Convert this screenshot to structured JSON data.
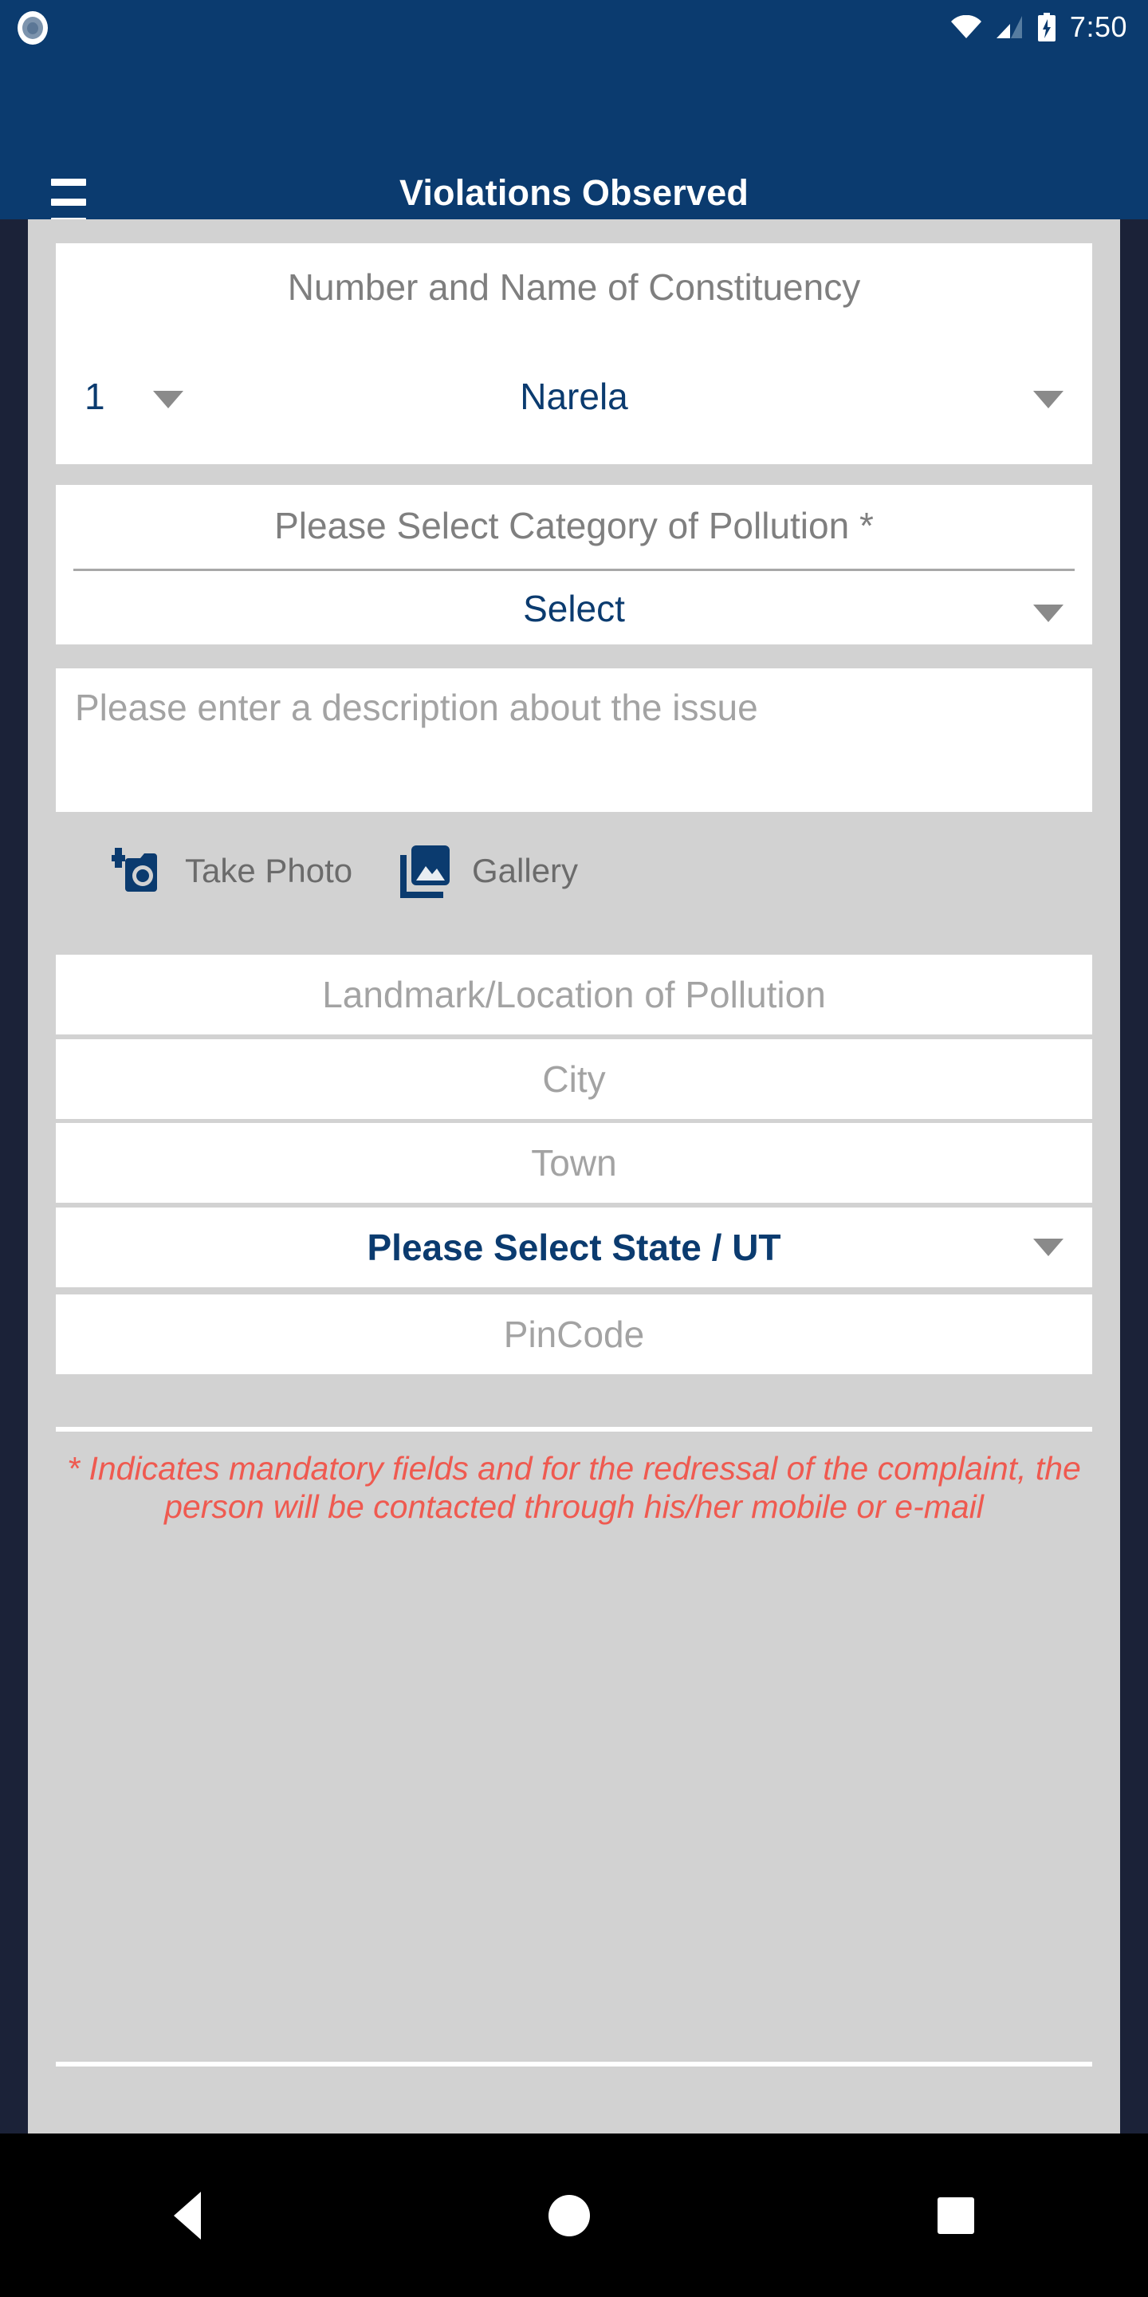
{
  "statusbar": {
    "time": "7:50",
    "icons": [
      "notification-dot-icon",
      "wifi-icon",
      "signal-icon",
      "battery-charging-icon"
    ]
  },
  "appbar": {
    "title": "Violations Observed",
    "menu_icon": "hamburger-menu-icon",
    "background": "#0b3b6f"
  },
  "form": {
    "constituency": {
      "label": "Number and Name of Constituency",
      "number": "1",
      "name": "Narela"
    },
    "category": {
      "label": "Please Select Category of Pollution *",
      "value": "Select"
    },
    "description": {
      "placeholder": "Please enter a description about the issue",
      "value": ""
    },
    "photo": {
      "take_photo_label": "Take Photo",
      "take_photo_icon": "add-a-photo-icon",
      "gallery_label": "Gallery",
      "gallery_icon": "photo-library-icon"
    },
    "landmark": {
      "placeholder": "Landmark/Location of Pollution",
      "value": ""
    },
    "city": {
      "placeholder": "City",
      "value": ""
    },
    "town": {
      "placeholder": "Town",
      "value": ""
    },
    "state": {
      "value": "Please Select State / UT"
    },
    "pincode": {
      "placeholder": "PinCode",
      "value": ""
    },
    "mandatory_note": "* Indicates mandatory fields and for the redressal of the complaint, the person will be contacted through his/her mobile or e-mail"
  },
  "colors": {
    "primary": "#0b3b6f",
    "panel_background": "#d2d2d2",
    "card_background": "#ffffff",
    "placeholder_text": "#a3a3a3",
    "label_text": "#7f7f7f",
    "error_text": "#ef5a50",
    "navbar": "#000000"
  },
  "navbar": {
    "back_icon": "back-triangle-icon",
    "home_icon": "home-circle-icon",
    "recents_icon": "recents-square-icon"
  }
}
